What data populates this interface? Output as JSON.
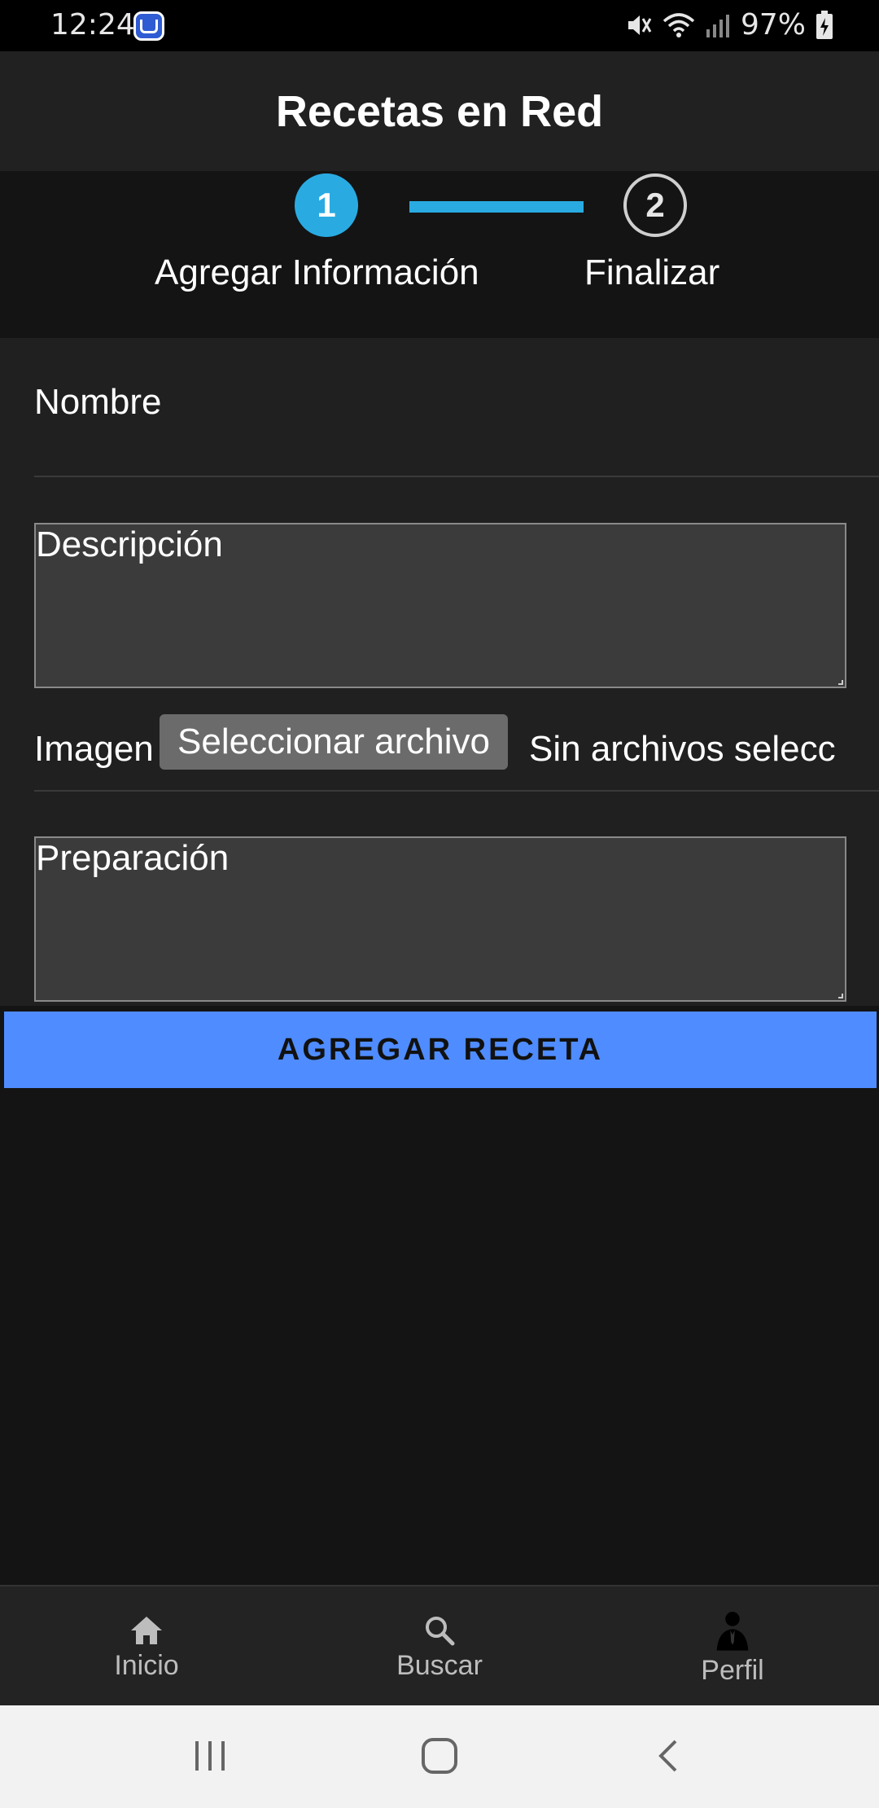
{
  "status_bar": {
    "time": "12:24",
    "battery": "97%"
  },
  "app_bar": {
    "title": "Recetas en Red"
  },
  "stepper": {
    "steps": [
      {
        "number": "1",
        "label": "Agregar Información",
        "active": true
      },
      {
        "number": "2",
        "label": "Finalizar",
        "active": false
      }
    ],
    "accent_color": "#29abe2"
  },
  "form": {
    "name_label": "Nombre",
    "description_label": "Descripción",
    "image_label": "Imagen",
    "file_button_label": "Seleccionar archivo",
    "file_status": "Sin archivos selecc",
    "preparation_label": "Preparación",
    "submit_label": "AGREGAR RECETA",
    "submit_color": "#4f8cff"
  },
  "bottom_nav": {
    "items": [
      {
        "label": "Inicio",
        "icon": "home-icon"
      },
      {
        "label": "Buscar",
        "icon": "search-icon"
      },
      {
        "label": "Perfil",
        "icon": "person-icon"
      }
    ]
  },
  "system_nav": {
    "buttons": [
      "recents-icon",
      "home-circle-icon",
      "back-icon"
    ]
  }
}
